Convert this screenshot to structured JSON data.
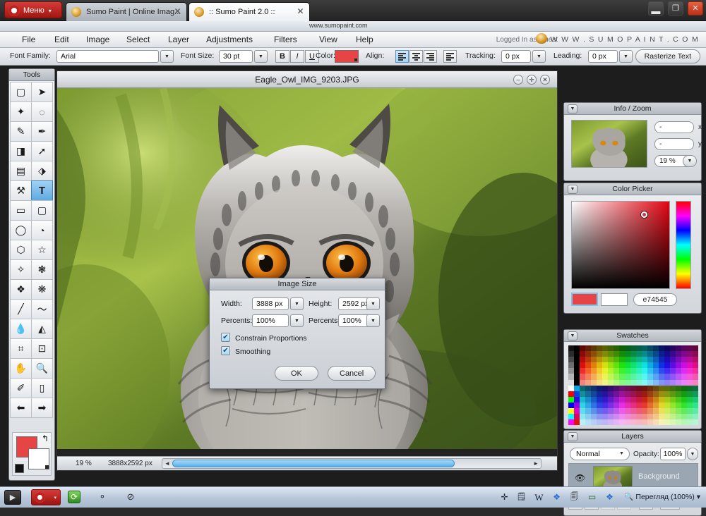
{
  "browser": {
    "opera_menu_label": "Меню",
    "opera_menu_caret": "▾",
    "tabs": [
      {
        "title": "Sumo Paint | Online Imag...",
        "close": "✕",
        "active": false
      },
      {
        "title": ":: Sumo Paint 2.0 ::",
        "close": "✕",
        "active": true
      }
    ],
    "address": "www.sumopaint.com",
    "window_controls": {
      "minimize": "▬",
      "restore": "❐",
      "close": "✕"
    }
  },
  "menubar": {
    "items": [
      "File",
      "Edit",
      "Image",
      "Select",
      "Layer",
      "Adjustments",
      "Filters",
      "View",
      "Help"
    ],
    "login_status": "Logged In as Guest",
    "brand": "W W W . S U M O P A I N T . C O M"
  },
  "options_toolbar": {
    "font_family_label": "Font Family:",
    "font_family_value": "Arial",
    "font_size_label": "Font Size:",
    "font_size_value": "30 pt",
    "bold": "B",
    "italic": "I",
    "underline": "U",
    "color_label": "Color:",
    "color_value": "#e74545",
    "align_label": "Align:",
    "tracking_label": "Tracking:",
    "tracking_value": "0 px",
    "leading_label": "Leading:",
    "leading_value": "0 px",
    "rasterize_label": "Rasterize Text",
    "caret": "▼"
  },
  "tools": {
    "title": "Tools",
    "items": [
      {
        "name": "marquee-select-tool",
        "glyph": "▢",
        "selected": false
      },
      {
        "name": "move-tool",
        "glyph": "➤",
        "selected": false
      },
      {
        "name": "magic-wand-tool",
        "glyph": "✦",
        "selected": false
      },
      {
        "name": "lasso-tool",
        "glyph": "◌",
        "selected": false
      },
      {
        "name": "brush-tool",
        "glyph": "✎",
        "selected": false
      },
      {
        "name": "ink-pen-tool",
        "glyph": "✒",
        "selected": false
      },
      {
        "name": "eraser-tool",
        "glyph": "◨",
        "selected": false
      },
      {
        "name": "smudge-tool",
        "glyph": "➚",
        "selected": false
      },
      {
        "name": "gradient-tool",
        "glyph": "▤",
        "selected": false
      },
      {
        "name": "paint-bucket-tool",
        "glyph": "⬗",
        "selected": false
      },
      {
        "name": "clone-stamp-tool",
        "glyph": "⚒",
        "selected": false
      },
      {
        "name": "text-tool",
        "glyph": "T",
        "selected": true
      },
      {
        "name": "rectangle-tool",
        "glyph": "▭",
        "selected": false
      },
      {
        "name": "rounded-rectangle-tool",
        "glyph": "▢",
        "selected": false
      },
      {
        "name": "ellipse-tool",
        "glyph": "◯",
        "selected": false
      },
      {
        "name": "pie-shape-tool",
        "glyph": "◔",
        "selected": false
      },
      {
        "name": "polygon-tool",
        "glyph": "⬡",
        "selected": false
      },
      {
        "name": "star-tool",
        "glyph": "☆",
        "selected": false
      },
      {
        "name": "burst-tool",
        "glyph": "✧",
        "selected": false
      },
      {
        "name": "splat-tool",
        "glyph": "❃",
        "selected": false
      },
      {
        "name": "blob-tool",
        "glyph": "❖",
        "selected": false
      },
      {
        "name": "snowflake-tool",
        "glyph": "❋",
        "selected": false
      },
      {
        "name": "line-tool",
        "glyph": "╱",
        "selected": false
      },
      {
        "name": "curve-tool",
        "glyph": "〜",
        "selected": false
      },
      {
        "name": "blur-drop-tool",
        "glyph": "💧",
        "selected": false
      },
      {
        "name": "sharpen-tool",
        "glyph": "◭",
        "selected": false
      },
      {
        "name": "crop-tool",
        "glyph": "⌗",
        "selected": false
      },
      {
        "name": "transform-tool",
        "glyph": "⊡",
        "selected": false
      },
      {
        "name": "hand-tool",
        "glyph": "✋",
        "selected": false
      },
      {
        "name": "zoom-tool",
        "glyph": "🔍",
        "selected": false
      },
      {
        "name": "eyedropper-tool",
        "glyph": "✐",
        "selected": false
      },
      {
        "name": "note-tool",
        "glyph": "▯",
        "selected": false
      },
      {
        "name": "prev-tool",
        "glyph": "⬅",
        "selected": false
      },
      {
        "name": "next-tool",
        "glyph": "➡",
        "selected": false
      }
    ],
    "foreground_color": "#e74545",
    "background_color": "#ffffff",
    "swap_arrow": "↰"
  },
  "canvas_window": {
    "title": "Eagle_Owl_IMG_9203.JPG",
    "minimize": "–",
    "maximize": "✛",
    "close": "✕",
    "status_zoom": "19 %",
    "status_dimensions": "3888x2592 px",
    "scroll_left_arrow": "◄",
    "scroll_right_arrow": "►"
  },
  "panels": {
    "info_zoom": {
      "title": "Info / Zoom",
      "collapse": "▼",
      "x_label": "x",
      "y_label": "y",
      "x_value": "-",
      "y_value": "-",
      "zoom_value": "19 %",
      "zoom_caret": "▼"
    },
    "color_picker": {
      "title": "Color Picker",
      "collapse": "▼",
      "hex_value": "e74545",
      "foreground": "#e74545",
      "background": "#ffffff"
    },
    "swatches": {
      "title": "Swatches",
      "collapse": "▼"
    },
    "layers": {
      "title": "Layers",
      "collapse": "▼",
      "blend_mode": "Normal",
      "blend_caret": "▼",
      "opacity_label": "Opacity:",
      "opacity_value": "100%",
      "opacity_caret": "▼",
      "layer_name": "Background",
      "eye": "👁",
      "buttons": [
        {
          "name": "new-layer-button",
          "glyph": "🗋"
        },
        {
          "name": "duplicate-layer-button",
          "glyph": "▯"
        },
        {
          "name": "move-layer-up-button",
          "glyph": "✦"
        },
        {
          "name": "move-layer-down-button",
          "glyph": "✧"
        },
        {
          "name": "layer-effects-button",
          "glyph": "🅰"
        },
        {
          "name": "layer-settings-button",
          "glyph": "⚙"
        }
      ]
    }
  },
  "dialog": {
    "title": "Image Size",
    "width_label": "Width:",
    "width_value": "3888 px",
    "height_label": "Height:",
    "height_value": "2592 px",
    "width_percent_label": "Percents:",
    "width_percent_value": "100%",
    "height_percent_label": "Percents:",
    "height_percent_value": "100%",
    "constrain_label": "Constrain Proportions",
    "constrain_checked": "✔",
    "smoothing_label": "Smoothing",
    "smoothing_checked": "✔",
    "ok_label": "OK",
    "cancel_label": "Cancel",
    "caret": "▼"
  },
  "taskbar": {
    "start_glyph": "▶",
    "opera_caret": "▾",
    "quick_icons": [
      {
        "name": "refresh-icon",
        "glyph": "⟳"
      },
      {
        "name": "share-icon",
        "glyph": "⚬"
      },
      {
        "name": "block-icon",
        "glyph": "⊘"
      }
    ],
    "tray_icons": [
      {
        "name": "plus-icon",
        "glyph": "✛"
      },
      {
        "name": "clipboard-icon",
        "glyph": "🗒"
      },
      {
        "name": "word-icon",
        "glyph": "W"
      },
      {
        "name": "messenger-icon",
        "glyph": "❖"
      },
      {
        "name": "copy-icon",
        "glyph": "🗐"
      },
      {
        "name": "monitor-icon",
        "glyph": "▭"
      },
      {
        "name": "contacts-icon",
        "glyph": "❖"
      }
    ],
    "zoom_indicator": "Перегляд (100%)",
    "zoom_caret": "▾"
  }
}
